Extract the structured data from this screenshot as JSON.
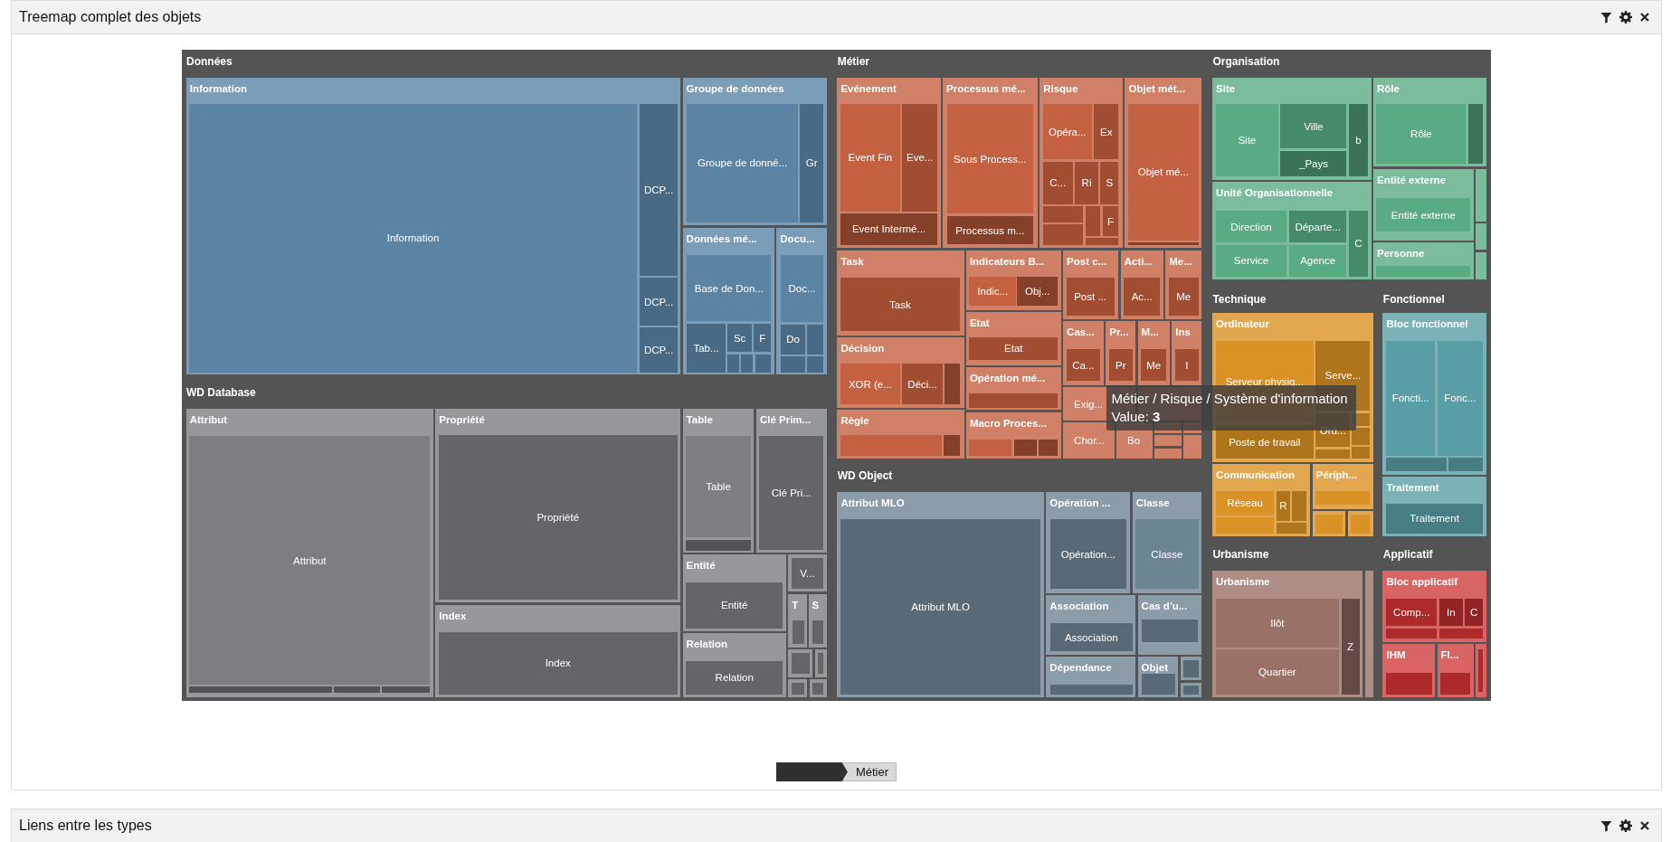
{
  "panels": [
    {
      "title": "Treemap complet des objets",
      "treemap": {
        "groups": [
          {
            "title": "Données",
            "color": "#7b9db7",
            "categories": [
              {
                "kind": "category",
                "title": "Information",
                "leaves": [
                  {
                    "label": "Information"
                  },
                  {
                    "label": "DCP..."
                  },
                  {
                    "label": "DCP..."
                  },
                  {
                    "label": "DCP..."
                  }
                ]
              },
              {
                "kind": "category",
                "title": "Groupe de données",
                "leaves": [
                  {
                    "label": "Groupe de donné..."
                  },
                  {
                    "label": "Gr"
                  }
                ]
              },
              {
                "kind": "category",
                "title": "Données mé...",
                "leaves": [
                  {
                    "label": "Base de Don..."
                  },
                  {
                    "label": "Tab..."
                  },
                  {
                    "label": "Sc"
                  },
                  {
                    "label": "F"
                  }
                ]
              },
              {
                "kind": "category",
                "title": "Docu...",
                "leaves": [
                  {
                    "label": "Doc..."
                  },
                  {
                    "label": "Do"
                  }
                ]
              }
            ]
          },
          {
            "title": "WD Database",
            "color": "#97989c",
            "categories": [
              {
                "kind": "category",
                "title": "Attribut",
                "leaves": [
                  {
                    "label": "Attribut"
                  }
                ]
              },
              {
                "kind": "category",
                "title": "Propriété",
                "leaves": [
                  {
                    "label": "Propriété"
                  }
                ]
              },
              {
                "kind": "category",
                "title": "Index",
                "leaves": [
                  {
                    "label": "Index"
                  }
                ]
              },
              {
                "kind": "category",
                "title": "Table",
                "leaves": [
                  {
                    "label": "Table"
                  }
                ]
              },
              {
                "kind": "category",
                "title": "Clé Prim...",
                "leaves": [
                  {
                    "label": "Clé Pri..."
                  }
                ]
              },
              {
                "kind": "category",
                "title": "Entité",
                "leaves": [
                  {
                    "label": "Entité"
                  }
                ]
              },
              {
                "kind": "category",
                "title": "Relation",
                "leaves": [
                  {
                    "label": "Relation"
                  }
                ]
              },
              {
                "kind": "tile",
                "label": "V..."
              },
              {
                "kind": "category",
                "title": "T"
              },
              {
                "kind": "category",
                "title": "S"
              }
            ]
          },
          {
            "title": "Métier",
            "color": "#d08066",
            "categories": [
              {
                "kind": "category",
                "title": "Evénement",
                "leaves": [
                  {
                    "label": "Event Fin"
                  },
                  {
                    "label": "Eve..."
                  },
                  {
                    "label": "Event Intermé..."
                  }
                ]
              },
              {
                "kind": "category",
                "title": "Processus mé...",
                "leaves": [
                  {
                    "label": "Sous Process..."
                  },
                  {
                    "label": "Processus m..."
                  }
                ]
              },
              {
                "kind": "category",
                "title": "Risque",
                "leaves": [
                  {
                    "label": "Opéra..."
                  },
                  {
                    "label": "Ex"
                  },
                  {
                    "label": "C..."
                  },
                  {
                    "label": "Ri"
                  },
                  {
                    "label": "S"
                  },
                  {
                    "label": "F"
                  }
                ]
              },
              {
                "kind": "category",
                "title": "Objet mét...",
                "leaves": [
                  {
                    "label": "Objet mé..."
                  }
                ]
              },
              {
                "kind": "category",
                "title": "Task",
                "leaves": [
                  {
                    "label": "Task"
                  }
                ]
              },
              {
                "kind": "category",
                "title": "Indicateurs B...",
                "leaves": [
                  {
                    "label": "Indic..."
                  },
                  {
                    "label": "Obj..."
                  }
                ]
              },
              {
                "kind": "category",
                "title": "Post c...",
                "leaves": [
                  {
                    "label": "Post ..."
                  }
                ]
              },
              {
                "kind": "category",
                "title": "Acti...",
                "leaves": [
                  {
                    "label": "Ac..."
                  }
                ]
              },
              {
                "kind": "category",
                "title": "Me...",
                "leaves": [
                  {
                    "label": "Me"
                  }
                ]
              },
              {
                "kind": "category",
                "title": "Décision",
                "leaves": [
                  {
                    "label": "XOR (e..."
                  },
                  {
                    "label": "Déci..."
                  }
                ]
              },
              {
                "kind": "category",
                "title": "Etat",
                "leaves": [
                  {
                    "label": "Etat"
                  }
                ]
              },
              {
                "kind": "category",
                "title": "Opération mé..."
              },
              {
                "kind": "category",
                "title": "Règle"
              },
              {
                "kind": "category",
                "title": "Macro Proces..."
              },
              {
                "kind": "category",
                "title": "Cas...",
                "leaves": [
                  {
                    "label": "Ca..."
                  }
                ]
              },
              {
                "kind": "category",
                "title": "Pr...",
                "leaves": [
                  {
                    "label": "Pr"
                  }
                ]
              },
              {
                "kind": "category",
                "title": "M...",
                "leaves": [
                  {
                    "label": "Me"
                  }
                ]
              },
              {
                "kind": "category",
                "title": "Ins",
                "leaves": [
                  {
                    "label": "I"
                  }
                ]
              },
              {
                "kind": "tile",
                "label": "Exig..."
              },
              {
                "kind": "tile",
                "label": "Chor..."
              },
              {
                "kind": "tile",
                "label": "Bo"
              }
            ]
          },
          {
            "title": "WD Object",
            "color": "#8a9da8",
            "categories": [
              {
                "kind": "category",
                "title": "Attribut MLO",
                "leaves": [
                  {
                    "label": "Attribut MLO"
                  }
                ]
              },
              {
                "kind": "category",
                "title": "Opération ...",
                "leaves": [
                  {
                    "label": "Opération..."
                  }
                ]
              },
              {
                "kind": "category",
                "title": "Classe",
                "leaves": [
                  {
                    "label": "Classe"
                  }
                ]
              },
              {
                "kind": "category",
                "title": "Association",
                "leaves": [
                  {
                    "label": "Association"
                  }
                ]
              },
              {
                "kind": "category",
                "title": "Cas d'u..."
              },
              {
                "kind": "category",
                "title": "Dépendance"
              },
              {
                "kind": "category",
                "title": "Objet"
              }
            ]
          },
          {
            "title": "Organisation",
            "color": "#7bbc9c",
            "categories": [
              {
                "kind": "category",
                "title": "Site",
                "leaves": [
                  {
                    "label": "Site"
                  },
                  {
                    "label": "Ville"
                  },
                  {
                    "label": "_Pays"
                  },
                  {
                    "label": "b"
                  }
                ]
              },
              {
                "kind": "category",
                "title": "Unité Organisationnelle",
                "leaves": [
                  {
                    "label": "Direction"
                  },
                  {
                    "label": "Départe..."
                  },
                  {
                    "label": "Service"
                  },
                  {
                    "label": "Agence"
                  },
                  {
                    "label": "C"
                  }
                ]
              },
              {
                "kind": "category",
                "title": "Rôle",
                "leaves": [
                  {
                    "label": "Rôle"
                  }
                ]
              },
              {
                "kind": "category",
                "title": "Entité externe",
                "leaves": [
                  {
                    "label": "Entité externe"
                  }
                ]
              },
              {
                "kind": "category",
                "title": "Personne"
              }
            ]
          },
          {
            "title": "Technique",
            "color": "#e2a74f",
            "categories": [
              {
                "kind": "category",
                "title": "Ordinateur",
                "leaves": [
                  {
                    "label": "Serveur physiq..."
                  },
                  {
                    "label": "Serve..."
                  },
                  {
                    "label": "Poste de travail"
                  },
                  {
                    "label": "Ord..."
                  }
                ]
              },
              {
                "kind": "category",
                "title": "Communication",
                "leaves": [
                  {
                    "label": "Réseau"
                  },
                  {
                    "label": "R"
                  }
                ]
              },
              {
                "kind": "category",
                "title": "Périph..."
              }
            ]
          },
          {
            "title": "Fonctionnel",
            "color": "#7ab2b8",
            "categories": [
              {
                "kind": "category",
                "title": "Bloc fonctionnel",
                "leaves": [
                  {
                    "label": "Foncti..."
                  },
                  {
                    "label": "Fonc..."
                  }
                ]
              },
              {
                "kind": "category",
                "title": "Traitement",
                "leaves": [
                  {
                    "label": "Traitement"
                  }
                ]
              }
            ]
          },
          {
            "title": "Urbanisme",
            "color": "#ad8d84",
            "categories": [
              {
                "kind": "category",
                "title": "Urbanisme",
                "leaves": [
                  {
                    "label": "Ilôt"
                  },
                  {
                    "label": "Quartier"
                  },
                  {
                    "label": "Z"
                  }
                ]
              }
            ]
          },
          {
            "title": "Applicatif",
            "color": "#d96464",
            "categories": [
              {
                "kind": "category",
                "title": "Bloc applicatif",
                "leaves": [
                  {
                    "label": "Comp..."
                  },
                  {
                    "label": "In"
                  },
                  {
                    "label": "C"
                  }
                ]
              },
              {
                "kind": "category",
                "title": "IHM"
              },
              {
                "kind": "category",
                "title": "Fl..."
              }
            ]
          }
        ],
        "tooltip": {
          "path": "Métier / Risque / Système d'information",
          "value": "Value: **3**"
        }
      },
      "breadcrumb": [
        {
          "kind": "root"
        },
        {
          "kind": "item",
          "label": "Métier"
        }
      ]
    },
    {
      "title": "Liens entre les types"
    }
  ]
}
